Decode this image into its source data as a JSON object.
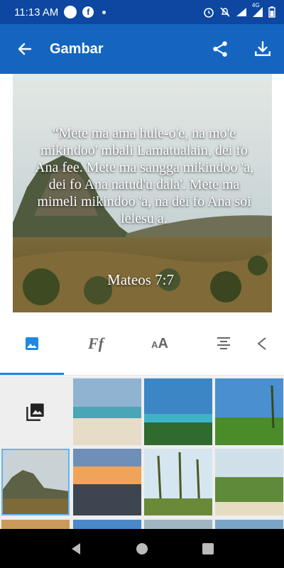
{
  "status_bar": {
    "time": "11:13 AM",
    "network_label": "4G",
    "icons": [
      "circle-notification-icon",
      "facebook-icon",
      "dot-icon",
      "alarm-icon",
      "mute-icon",
      "wifi-icon",
      "signal-icon",
      "battery-icon"
    ]
  },
  "toolbar": {
    "title": "Gambar",
    "back_icon": "arrow-back-icon",
    "share_icon": "share-icon",
    "download_icon": "download-icon"
  },
  "canvas": {
    "quote": "“Mete ma ama hule-o'e, na mo'e mikindoo' mbali Lamatualain, dei fo Ana fee. Mete ma sangga mikindoo 'a, dei fo Ana natud'u dala'. Mete ma mimeli mikindoo 'a, na dei fo Ana soi lelesu a.",
    "reference": "Mateos 7:7"
  },
  "tabs": [
    {
      "name": "image-tab",
      "icon": "image-icon",
      "active": true
    },
    {
      "name": "font-tab",
      "icon": "font-style-icon",
      "glyph": "Ff",
      "active": false
    },
    {
      "name": "text-size-tab",
      "icon": "text-size-icon",
      "glyph": "AA",
      "active": false
    },
    {
      "name": "align-tab",
      "icon": "align-center-icon",
      "active": false
    },
    {
      "name": "more-tab",
      "icon": "tag-icon",
      "active": false
    }
  ],
  "gallery": {
    "picker_icon": "photo-library-icon",
    "thumbnails": [
      "beach-shore",
      "tropical-beach-island",
      "rice-field-palms",
      "rocky-hill-savanna",
      "sunset-sea",
      "palm-trees-beach",
      "palm-path-beach"
    ],
    "selected": "rocky-hill-savanna"
  },
  "colors": {
    "status_bar": "#0d47a1",
    "toolbar": "#1565c0",
    "accent": "#1e88e5"
  }
}
